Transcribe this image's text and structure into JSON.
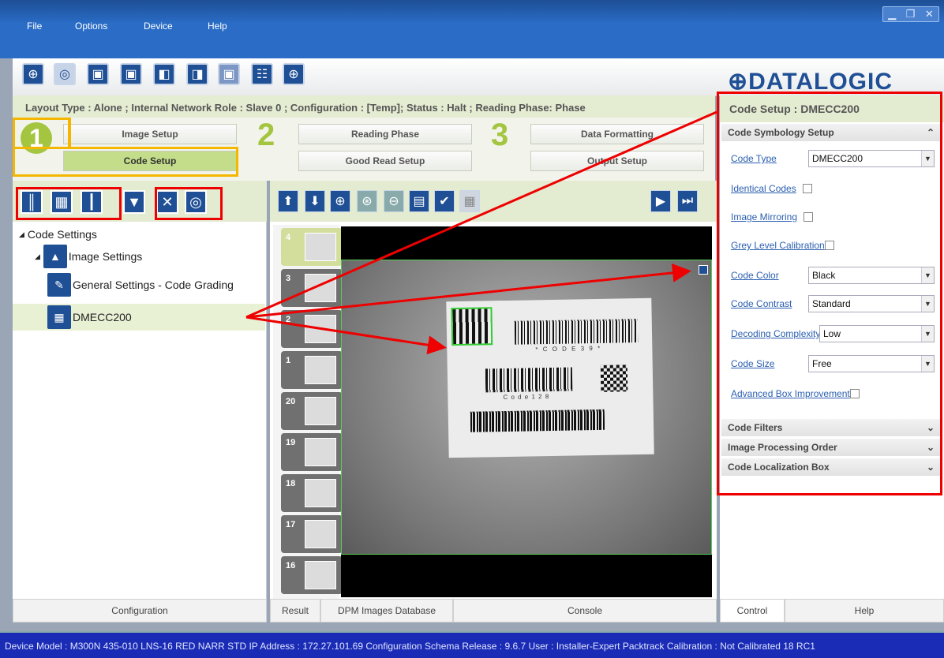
{
  "menu": {
    "file": "File",
    "options": "Options",
    "device": "Device",
    "help": "Help"
  },
  "brand": {
    "logo": "DATALOGIC",
    "logo_mark": "⊕"
  },
  "status_line": "Layout Type : Alone ; Internal Network Role : Slave 0 ; Configuration : [Temp]; Status : Halt ; Reading Phase: Phase",
  "steps": {
    "s1": {
      "num": "1",
      "a": "Image Setup",
      "b": "Code Setup"
    },
    "s2": {
      "num": "2",
      "a": "Reading Phase",
      "b": "Good Read Setup"
    },
    "s3": {
      "num": "3",
      "a": "Data Formatting",
      "b": "Output Setup"
    }
  },
  "tree": {
    "root": "Code Settings",
    "image_settings": "Image Settings",
    "general": "General Settings - Code Grading",
    "dmecc": "DMECC200"
  },
  "thumbnails": [
    "4",
    "3",
    "2",
    "1",
    "20",
    "19",
    "18",
    "17",
    "16"
  ],
  "image_labels": {
    "code39": "* C O D E   3 9 *",
    "code128": "C o d e   1 2 8"
  },
  "right_panel": {
    "title": "Code Setup :  DMECC200",
    "section_symbology": "Code Symbology Setup",
    "code_type_label": "Code Type",
    "code_type_value": "DMECC200",
    "identical_codes": "Identical Codes",
    "image_mirroring": "Image Mirroring",
    "grey_level": "Grey Level Calibration",
    "code_color_label": "Code Color",
    "code_color_value": "Black",
    "code_contrast_label": "Code Contrast",
    "code_contrast_value": "Standard",
    "decoding_label": "Decoding Complexity",
    "decoding_value": "Low",
    "code_size_label": "Code Size",
    "code_size_value": "Free",
    "advanced_box": "Advanced Box Improvement",
    "section_filters": "Code Filters",
    "section_processing": "Image Processing Order",
    "section_localization": "Code Localization Box"
  },
  "bottom_tabs": {
    "configuration": "Configuration",
    "result": "Result",
    "dpm": "DPM Images Database",
    "console": "Console",
    "control": "Control",
    "help": "Help"
  },
  "footer": "Device Model : M300N 435-010 LNS-16 RED NARR STD   IP Address :  172.27.101.69   Configuration Schema Release :  9.6.7   User : Installer-Expert   Packtrack Calibration : Not Calibrated 18 RC1",
  "colors": {
    "brand_blue": "#1f4f95",
    "accent_green": "#a3c540",
    "annotation_red": "#e00000",
    "annotation_orange": "#f5b600"
  }
}
